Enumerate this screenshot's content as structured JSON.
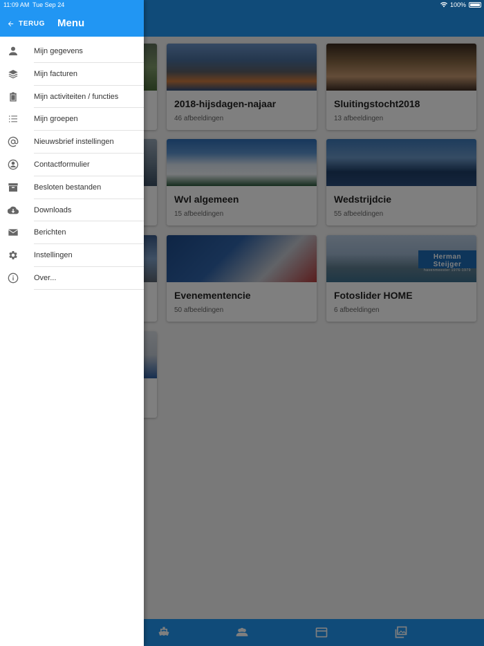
{
  "status_bar": {
    "time": "11:09 AM",
    "date": "Tue Sep 24",
    "battery": "100%"
  },
  "drawer": {
    "back_label": "TERUG",
    "title": "Menu",
    "items": [
      {
        "label": "Mijn gegevens",
        "icon": "person-icon"
      },
      {
        "label": "Mijn facturen",
        "icon": "layers-icon"
      },
      {
        "label": "Mijn activiteiten / functies",
        "icon": "clipboard-icon"
      },
      {
        "label": "Mijn groepen",
        "icon": "list-icon"
      },
      {
        "label": "Nieuwsbrief instellingen",
        "icon": "at-sign-icon"
      },
      {
        "label": "Contactformulier",
        "icon": "account-circle-icon"
      },
      {
        "label": "Besloten bestanden",
        "icon": "archive-icon"
      },
      {
        "label": "Downloads",
        "icon": "cloud-download-icon"
      },
      {
        "label": "Berichten",
        "icon": "mail-icon"
      },
      {
        "label": "Instellingen",
        "icon": "gear-icon"
      },
      {
        "label": "Over...",
        "icon": "info-icon"
      }
    ]
  },
  "albums": [
    {
      "title": "2018-hijsdagen-najaar",
      "count": "46 afbeeldingen"
    },
    {
      "title": "Sluitingstocht2018",
      "count": "13 afbeeldingen"
    },
    {
      "title": "Wvl algemeen",
      "count": "15 afbeeldingen"
    },
    {
      "title": "Wedstrijdcie",
      "count": "55 afbeeldingen"
    },
    {
      "title": "Evenementencie",
      "count": "50 afbeeldingen"
    },
    {
      "title": "Fotoslider HOME",
      "count": "6 afbeeldingen"
    }
  ],
  "photo_sign": {
    "line1": "Herman Steijger",
    "line2": "havenmeester 1976-1979"
  },
  "bottom_tabs": [
    "boat-icon",
    "group-icon",
    "calendar-icon",
    "photos-icon"
  ],
  "colors": {
    "primary": "#2196f3",
    "overlay": "rgba(0,0,0,0.5)"
  }
}
